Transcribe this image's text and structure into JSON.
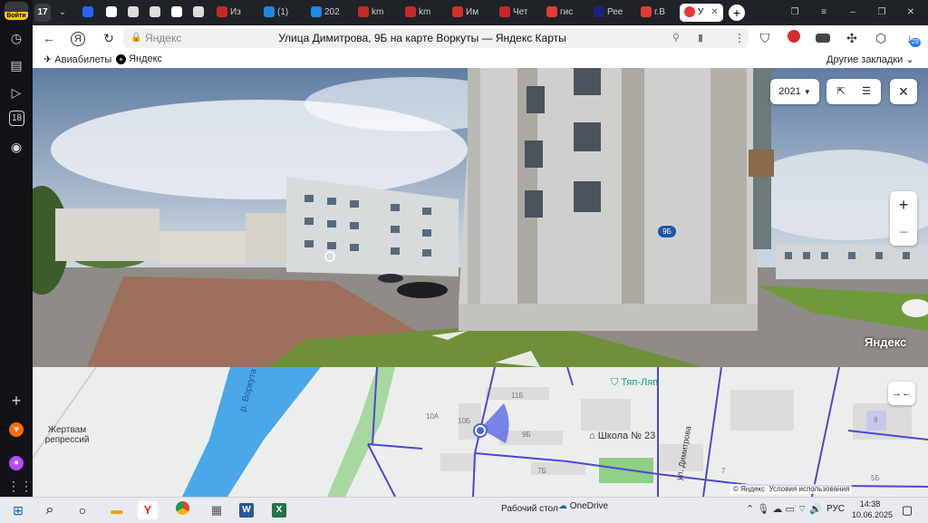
{
  "sidebar": {
    "login_label": "Войти",
    "badge_18": "18"
  },
  "tabs": {
    "counter": "17",
    "items": [
      {
        "label": "Из",
        "color": "#c62828"
      },
      {
        "label": "(1)",
        "color": "#1e88e5"
      },
      {
        "label": "202",
        "color": "#1e88e5"
      },
      {
        "label": "km",
        "color": "#c62828"
      },
      {
        "label": "km",
        "color": "#c62828"
      },
      {
        "label": "Им",
        "color": "#d32f2f"
      },
      {
        "label": "Чет",
        "color": "#c62828"
      },
      {
        "label": "гис",
        "color": "#e53935"
      },
      {
        "label": "Рее",
        "color": "#1a237e"
      },
      {
        "label": "г.В",
        "color": "#e53935"
      }
    ],
    "active_label": "У",
    "new_tab_symbol": "+"
  },
  "address": {
    "host": "Яндекс",
    "title": "Улица Димитрова, 9Б на карте Воркуты — Яндекс Карты",
    "download_badge": "29"
  },
  "bookmarks": {
    "items": [
      "Авиабилеты",
      "Яндекс"
    ],
    "other": "Другие закладки"
  },
  "panorama": {
    "year": "2021",
    "house_sign": "9Б",
    "watermark": "Яндекс",
    "zoom_in": "+",
    "zoom_out": "−"
  },
  "map": {
    "labels": {
      "river": "р. Воркута",
      "memorial": "Жертвам репрессий",
      "shop": "Тяп-Ляп",
      "school": "Школа № 23",
      "street": "ул. Димитрова",
      "b10a": "10А",
      "b10b": "10Б",
      "b11b": "11Б",
      "b9b": "9Б",
      "b7b": "7Б",
      "b7": "7",
      "b5b": "5Б",
      "b9": "9"
    },
    "copyright": "© Яндекс",
    "terms": "Условия использования"
  },
  "taskbar": {
    "desktop": "Рабочий стол",
    "onedrive": "OneDrive",
    "lang": "РУС",
    "time": "14:38",
    "date": "10.06.2025"
  }
}
